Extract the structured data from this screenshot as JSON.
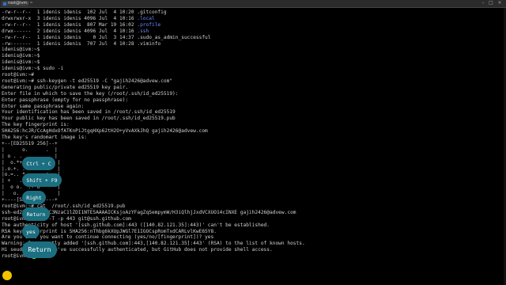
{
  "window": {
    "tab_title": "root@ivm: ~",
    "toolbar_icons": [
      "minimize-icon",
      "maximize-icon",
      "close-icon"
    ]
  },
  "terminal_lines": [
    "-rw-r--r--  1 idenis idenis  102 Jul  4 10:20 .gitconfig",
    "drwxrwxr-x  3 idenis idenis 4096 Jul  4 10:16 .local",
    "-rw-r--r--  1 idenis idenis  807 Mar 19 16:02 .profile",
    "drwx------  2 idenis idenis 4096 Jul  4 10:16 .ssh",
    "-rw-r--r--  1 idenis idenis    0 Jul  3 14:37 .sudo_as_admin_successful",
    "-rw-------  1 idenis idenis  707 Jul  4 10:28 .viminfo",
    "idenis@ivm:~$",
    "idenis@ivm:~$",
    "idenis@ivm:~$",
    "idenis@ivm:~$ sudo -i",
    "root@ivm:~#",
    "root@ivm:~# ssh-keygen -t ed25519 -C \"gajih2426@advew.com\"",
    "Generating public/private ed25519 key pair.",
    "Enter file in which to save the key (/root/.ssh/id_ed25519):",
    "Enter passphrase (empty for no passphrase):",
    "Enter same passphrase again:",
    "Your identification has been saved in /root/.ssh/id_ed25519",
    "Your public key has been saved in /root/.ssh/id_ed25519.pub",
    "The key fingerprint is:",
    "SHA256:hcJR/CcAgHdxOfATKnPiJtgqHXp62tH2O+yVvAXkJhQ gajih2426@advew.com",
    "The key's randomart image is:",
    "+--[ED25519 256]--+",
    "|      o.      .  |",
    "| o . .  .     .  |",
    "|  o.*+ . .      . |",
    "|.o.+. . S .   .   |",
    "|o.=.. *  .  . o . |",
    "| +   . o  = .     |",
    "|  o o.  .+ o      |",
    "|   o.    .        |",
    "+----[SHA256]-----+",
    "root@ivm:~# cat  /root/.ssh/id_ed25519.pub",
    "ssh-ed25519 AAAAC3NzaC1lZDI1NTE5AAAAICKsjoAzYFagZqSempymW/H3iQlhjJxdVCXUO14cINXE gajih2426@advew.com",
    "root@ivm:~# ssh -T -p 443 git@ssh.github.com",
    "The authenticity of host '[ssh.github.com]:443 ([140.82.121.35]:443)' can't be established.",
    "RSA key fingerprint is SHA256:nThbg6kXUpJWGl7E1IGOCspRomTxdCARLvlKwE6SY8.",
    "Are you sure you want to continue connecting (yes/no/[fingerprint])? yes",
    "Warning: Permanently added '[ssh.github.com]:443,[140.82.121.35]:443' (RSA) to the list of known hosts.",
    "Hi seudofo2142! You've successfully authenticated, but GitHub does not provide shell access.",
    "root@ivm:~# "
  ],
  "key_overlays": [
    {
      "label": "Ctrl + C"
    },
    {
      "label": "Shift + F9"
    },
    {
      "label": "Right"
    },
    {
      "label": "Return"
    },
    {
      "label": "yes"
    },
    {
      "label": "Return"
    }
  ],
  "colors": {
    "prompt_green": "#4fc94f",
    "dir_blue": "#6b8cff",
    "overlay_teal": "#1b6f80",
    "pointer_yellow": "#f2c200"
  }
}
